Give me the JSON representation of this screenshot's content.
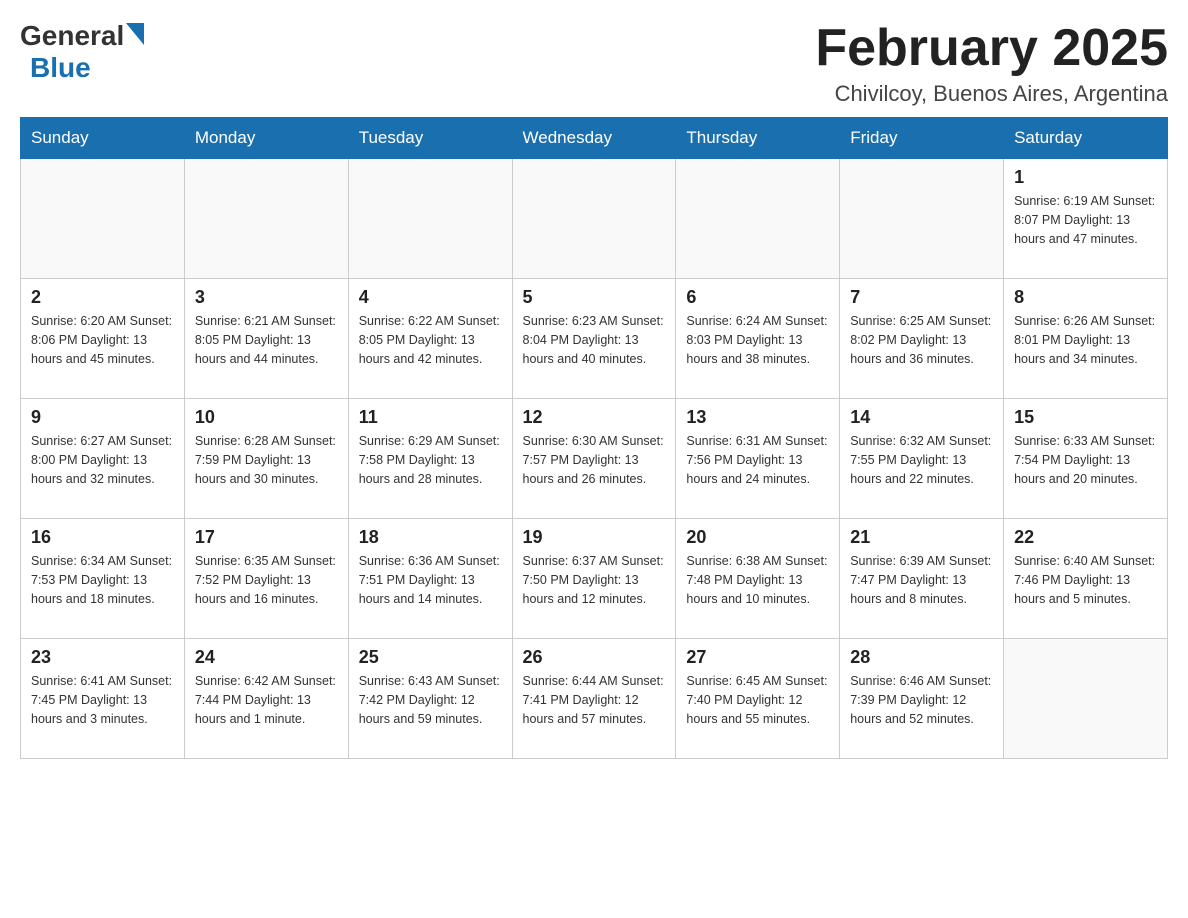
{
  "header": {
    "logo_general": "General",
    "logo_blue": "Blue",
    "month_title": "February 2025",
    "location": "Chivilcoy, Buenos Aires, Argentina"
  },
  "weekdays": [
    "Sunday",
    "Monday",
    "Tuesday",
    "Wednesday",
    "Thursday",
    "Friday",
    "Saturday"
  ],
  "weeks": [
    [
      {
        "day": "",
        "info": ""
      },
      {
        "day": "",
        "info": ""
      },
      {
        "day": "",
        "info": ""
      },
      {
        "day": "",
        "info": ""
      },
      {
        "day": "",
        "info": ""
      },
      {
        "day": "",
        "info": ""
      },
      {
        "day": "1",
        "info": "Sunrise: 6:19 AM\nSunset: 8:07 PM\nDaylight: 13 hours and 47 minutes."
      }
    ],
    [
      {
        "day": "2",
        "info": "Sunrise: 6:20 AM\nSunset: 8:06 PM\nDaylight: 13 hours and 45 minutes."
      },
      {
        "day": "3",
        "info": "Sunrise: 6:21 AM\nSunset: 8:05 PM\nDaylight: 13 hours and 44 minutes."
      },
      {
        "day": "4",
        "info": "Sunrise: 6:22 AM\nSunset: 8:05 PM\nDaylight: 13 hours and 42 minutes."
      },
      {
        "day": "5",
        "info": "Sunrise: 6:23 AM\nSunset: 8:04 PM\nDaylight: 13 hours and 40 minutes."
      },
      {
        "day": "6",
        "info": "Sunrise: 6:24 AM\nSunset: 8:03 PM\nDaylight: 13 hours and 38 minutes."
      },
      {
        "day": "7",
        "info": "Sunrise: 6:25 AM\nSunset: 8:02 PM\nDaylight: 13 hours and 36 minutes."
      },
      {
        "day": "8",
        "info": "Sunrise: 6:26 AM\nSunset: 8:01 PM\nDaylight: 13 hours and 34 minutes."
      }
    ],
    [
      {
        "day": "9",
        "info": "Sunrise: 6:27 AM\nSunset: 8:00 PM\nDaylight: 13 hours and 32 minutes."
      },
      {
        "day": "10",
        "info": "Sunrise: 6:28 AM\nSunset: 7:59 PM\nDaylight: 13 hours and 30 minutes."
      },
      {
        "day": "11",
        "info": "Sunrise: 6:29 AM\nSunset: 7:58 PM\nDaylight: 13 hours and 28 minutes."
      },
      {
        "day": "12",
        "info": "Sunrise: 6:30 AM\nSunset: 7:57 PM\nDaylight: 13 hours and 26 minutes."
      },
      {
        "day": "13",
        "info": "Sunrise: 6:31 AM\nSunset: 7:56 PM\nDaylight: 13 hours and 24 minutes."
      },
      {
        "day": "14",
        "info": "Sunrise: 6:32 AM\nSunset: 7:55 PM\nDaylight: 13 hours and 22 minutes."
      },
      {
        "day": "15",
        "info": "Sunrise: 6:33 AM\nSunset: 7:54 PM\nDaylight: 13 hours and 20 minutes."
      }
    ],
    [
      {
        "day": "16",
        "info": "Sunrise: 6:34 AM\nSunset: 7:53 PM\nDaylight: 13 hours and 18 minutes."
      },
      {
        "day": "17",
        "info": "Sunrise: 6:35 AM\nSunset: 7:52 PM\nDaylight: 13 hours and 16 minutes."
      },
      {
        "day": "18",
        "info": "Sunrise: 6:36 AM\nSunset: 7:51 PM\nDaylight: 13 hours and 14 minutes."
      },
      {
        "day": "19",
        "info": "Sunrise: 6:37 AM\nSunset: 7:50 PM\nDaylight: 13 hours and 12 minutes."
      },
      {
        "day": "20",
        "info": "Sunrise: 6:38 AM\nSunset: 7:48 PM\nDaylight: 13 hours and 10 minutes."
      },
      {
        "day": "21",
        "info": "Sunrise: 6:39 AM\nSunset: 7:47 PM\nDaylight: 13 hours and 8 minutes."
      },
      {
        "day": "22",
        "info": "Sunrise: 6:40 AM\nSunset: 7:46 PM\nDaylight: 13 hours and 5 minutes."
      }
    ],
    [
      {
        "day": "23",
        "info": "Sunrise: 6:41 AM\nSunset: 7:45 PM\nDaylight: 13 hours and 3 minutes."
      },
      {
        "day": "24",
        "info": "Sunrise: 6:42 AM\nSunset: 7:44 PM\nDaylight: 13 hours and 1 minute."
      },
      {
        "day": "25",
        "info": "Sunrise: 6:43 AM\nSunset: 7:42 PM\nDaylight: 12 hours and 59 minutes."
      },
      {
        "day": "26",
        "info": "Sunrise: 6:44 AM\nSunset: 7:41 PM\nDaylight: 12 hours and 57 minutes."
      },
      {
        "day": "27",
        "info": "Sunrise: 6:45 AM\nSunset: 7:40 PM\nDaylight: 12 hours and 55 minutes."
      },
      {
        "day": "28",
        "info": "Sunrise: 6:46 AM\nSunset: 7:39 PM\nDaylight: 12 hours and 52 minutes."
      },
      {
        "day": "",
        "info": ""
      }
    ]
  ]
}
